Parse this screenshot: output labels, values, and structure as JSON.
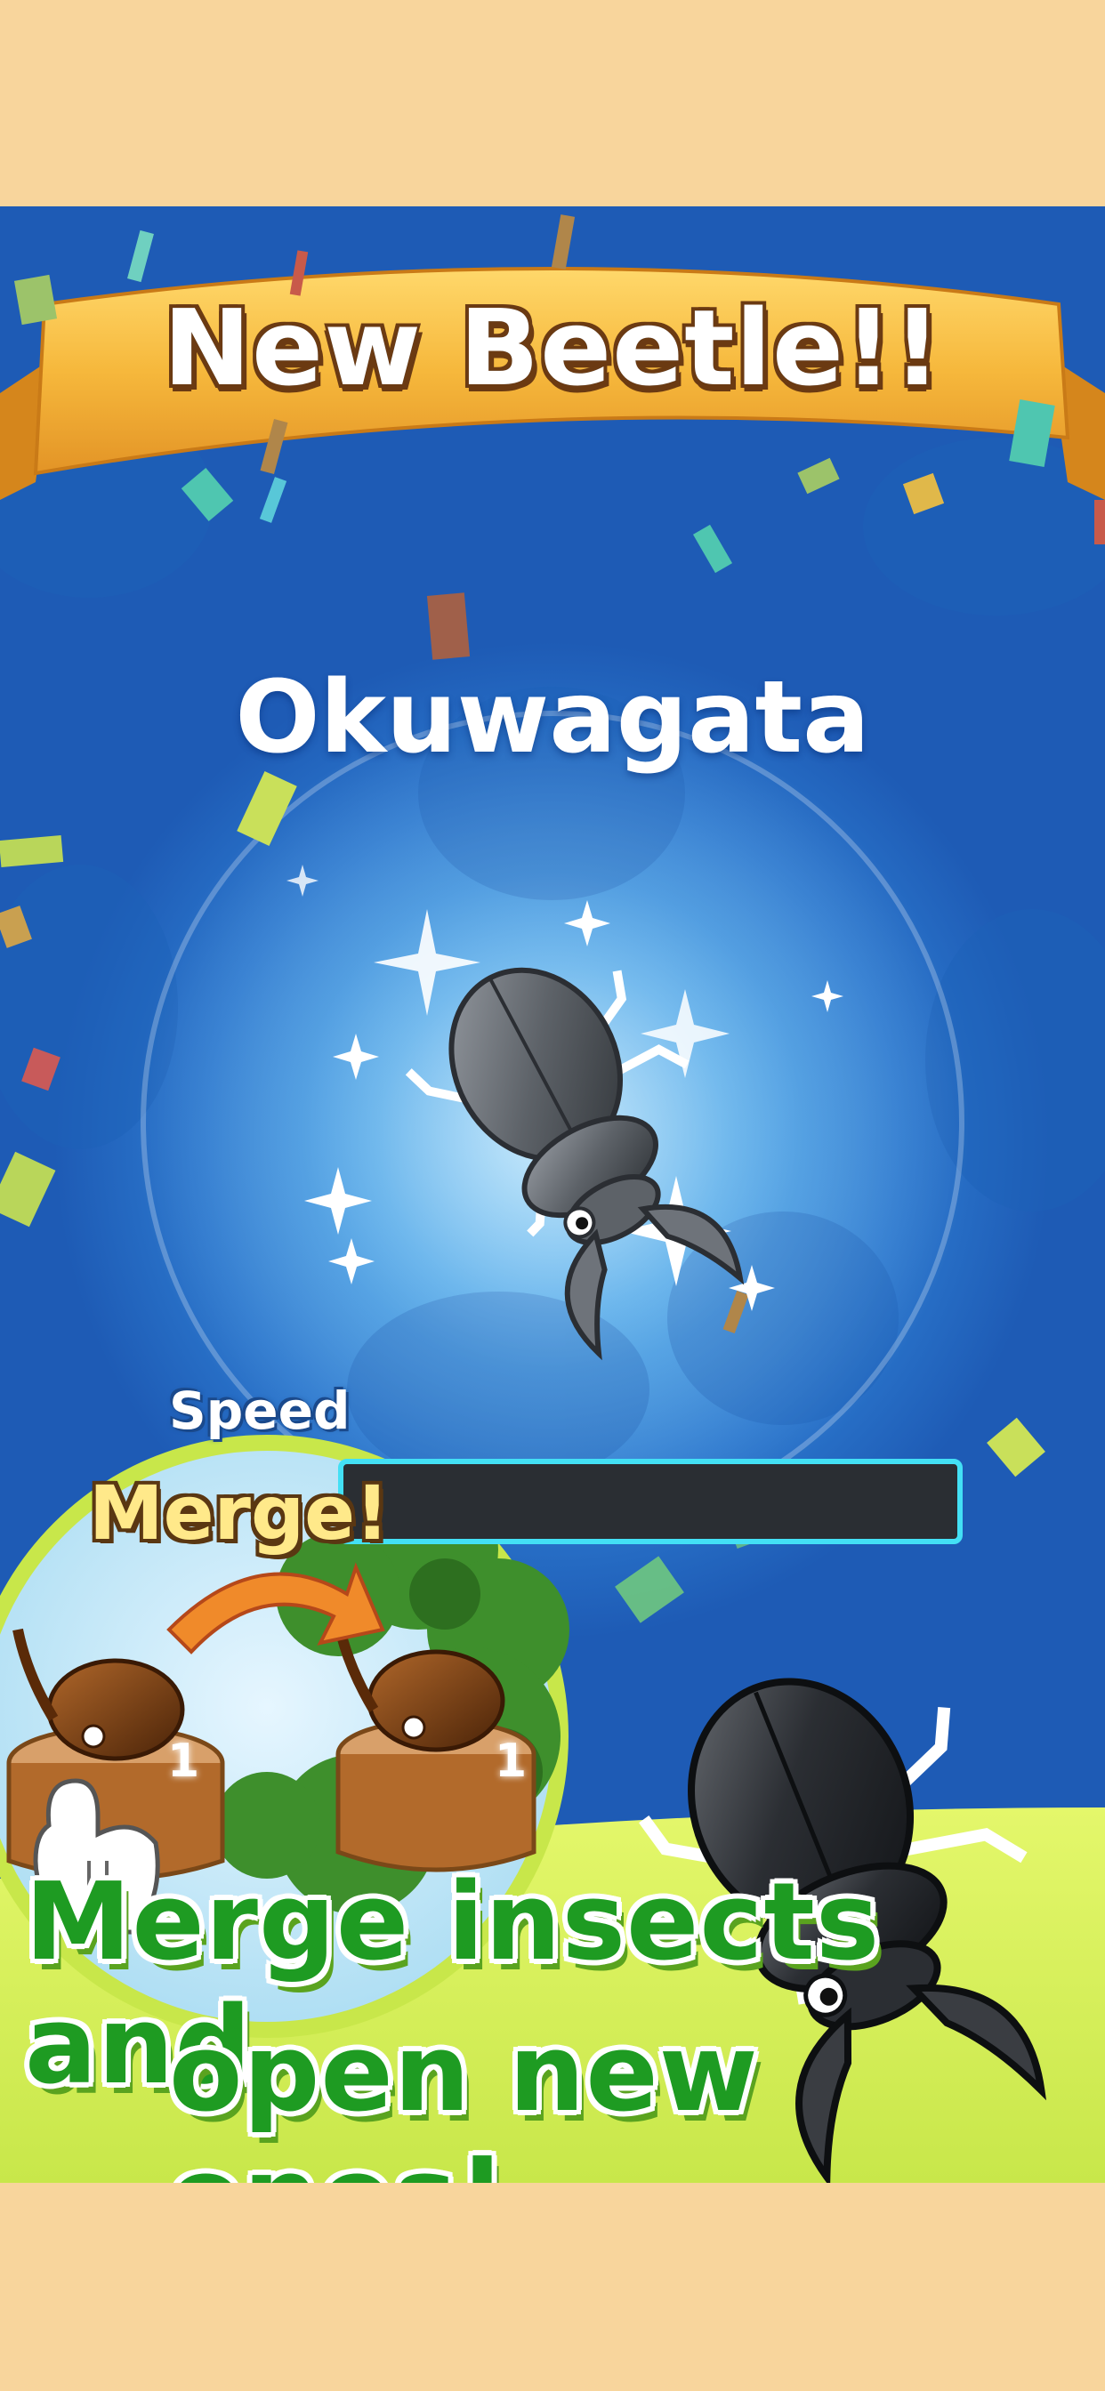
{
  "banner": {
    "title": "New Beetle!!"
  },
  "beetle": {
    "name": "Okuwagata"
  },
  "stats": {
    "speed_label": "Speed"
  },
  "tutorial": {
    "merge_label": "Merge!",
    "left_count": "1",
    "right_count": "1"
  },
  "caption": {
    "line1": "Merge insects and",
    "line2": "open new ones!"
  },
  "colors": {
    "background": "#f8d59c",
    "sky": "#2c79cf",
    "banner": "#f6b83c",
    "caption_green": "#1e9b22",
    "band_green": "#d6f05a",
    "speed_bar_border": "#43e0f5"
  },
  "icons": [
    "ribbon-banner",
    "stag-beetle-icon",
    "rhinoceros-beetle-icon",
    "tap-hand-icon",
    "merge-arrow-icon",
    "tree-stump-icon",
    "sparkle-icon",
    "confetti"
  ]
}
